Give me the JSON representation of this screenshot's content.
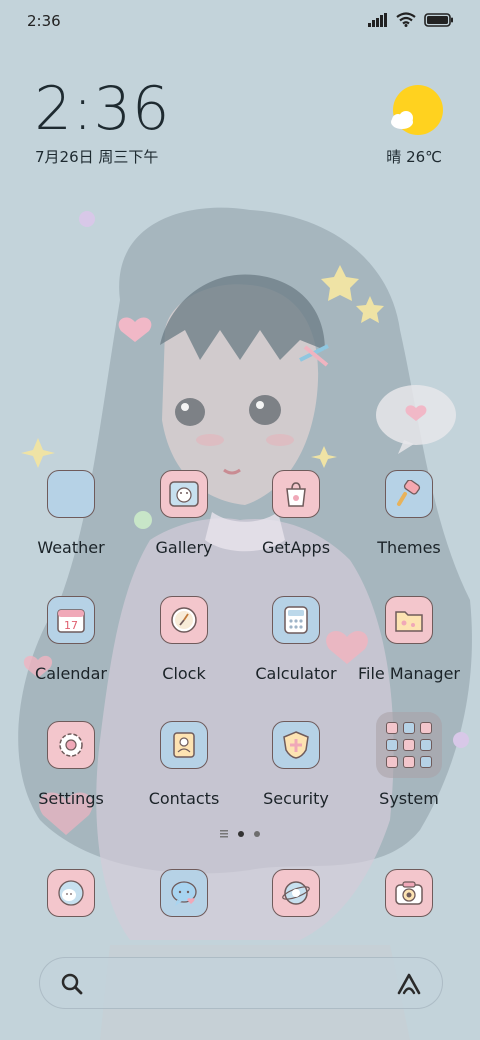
{
  "status_bar": {
    "time": "2:36"
  },
  "clock_widget": {
    "time": "2:36",
    "date": "7月26日 周三下午"
  },
  "weather_widget": {
    "condition": "晴",
    "temperature": "26℃",
    "icon": "sun-cloud-icon"
  },
  "apps": [
    {
      "label": "Weather",
      "icon": "weather-icon",
      "color": "#b6d2e6"
    },
    {
      "label": "Gallery",
      "icon": "gallery-icon",
      "color": "#f3c6cc"
    },
    {
      "label": "GetApps",
      "icon": "getapps-icon",
      "color": "#f3c6cc"
    },
    {
      "label": "Themes",
      "icon": "themes-icon",
      "color": "#b6d2e6"
    },
    {
      "label": "Calendar",
      "icon": "calendar-icon",
      "color": "#b6d2e6"
    },
    {
      "label": "Clock",
      "icon": "clock-icon",
      "color": "#f3c6cc"
    },
    {
      "label": "Calculator",
      "icon": "calculator-icon",
      "color": "#b6d2e6"
    },
    {
      "label": "File Manager",
      "icon": "file-manager-icon",
      "color": "#f3c6cc"
    },
    {
      "label": "Settings",
      "icon": "settings-icon",
      "color": "#f3c6cc"
    },
    {
      "label": "Contacts",
      "icon": "contacts-icon",
      "color": "#b6d2e6"
    },
    {
      "label": "Security",
      "icon": "security-icon",
      "color": "#b6d2e6"
    },
    {
      "label": "System",
      "icon": "folder-icon",
      "color": "#aaa0a5"
    }
  ],
  "calendar_day": "17",
  "page_indicator": {
    "pages": 2,
    "active": 1
  },
  "dock": [
    {
      "icon": "phone-icon",
      "color": "#f3c6cc"
    },
    {
      "icon": "messages-icon",
      "color": "#b6d2e6"
    },
    {
      "icon": "browser-icon",
      "color": "#f3c6cc"
    },
    {
      "icon": "camera-icon",
      "color": "#f3c6cc"
    }
  ],
  "search_bar": {
    "left_icon": "search-icon",
    "right_icon": "assistant-icon"
  },
  "colors": {
    "background": "#c3d3da",
    "pink_tile": "#f3c6cc",
    "blue_tile": "#b6d2e6",
    "sun": "#ffd21f"
  }
}
